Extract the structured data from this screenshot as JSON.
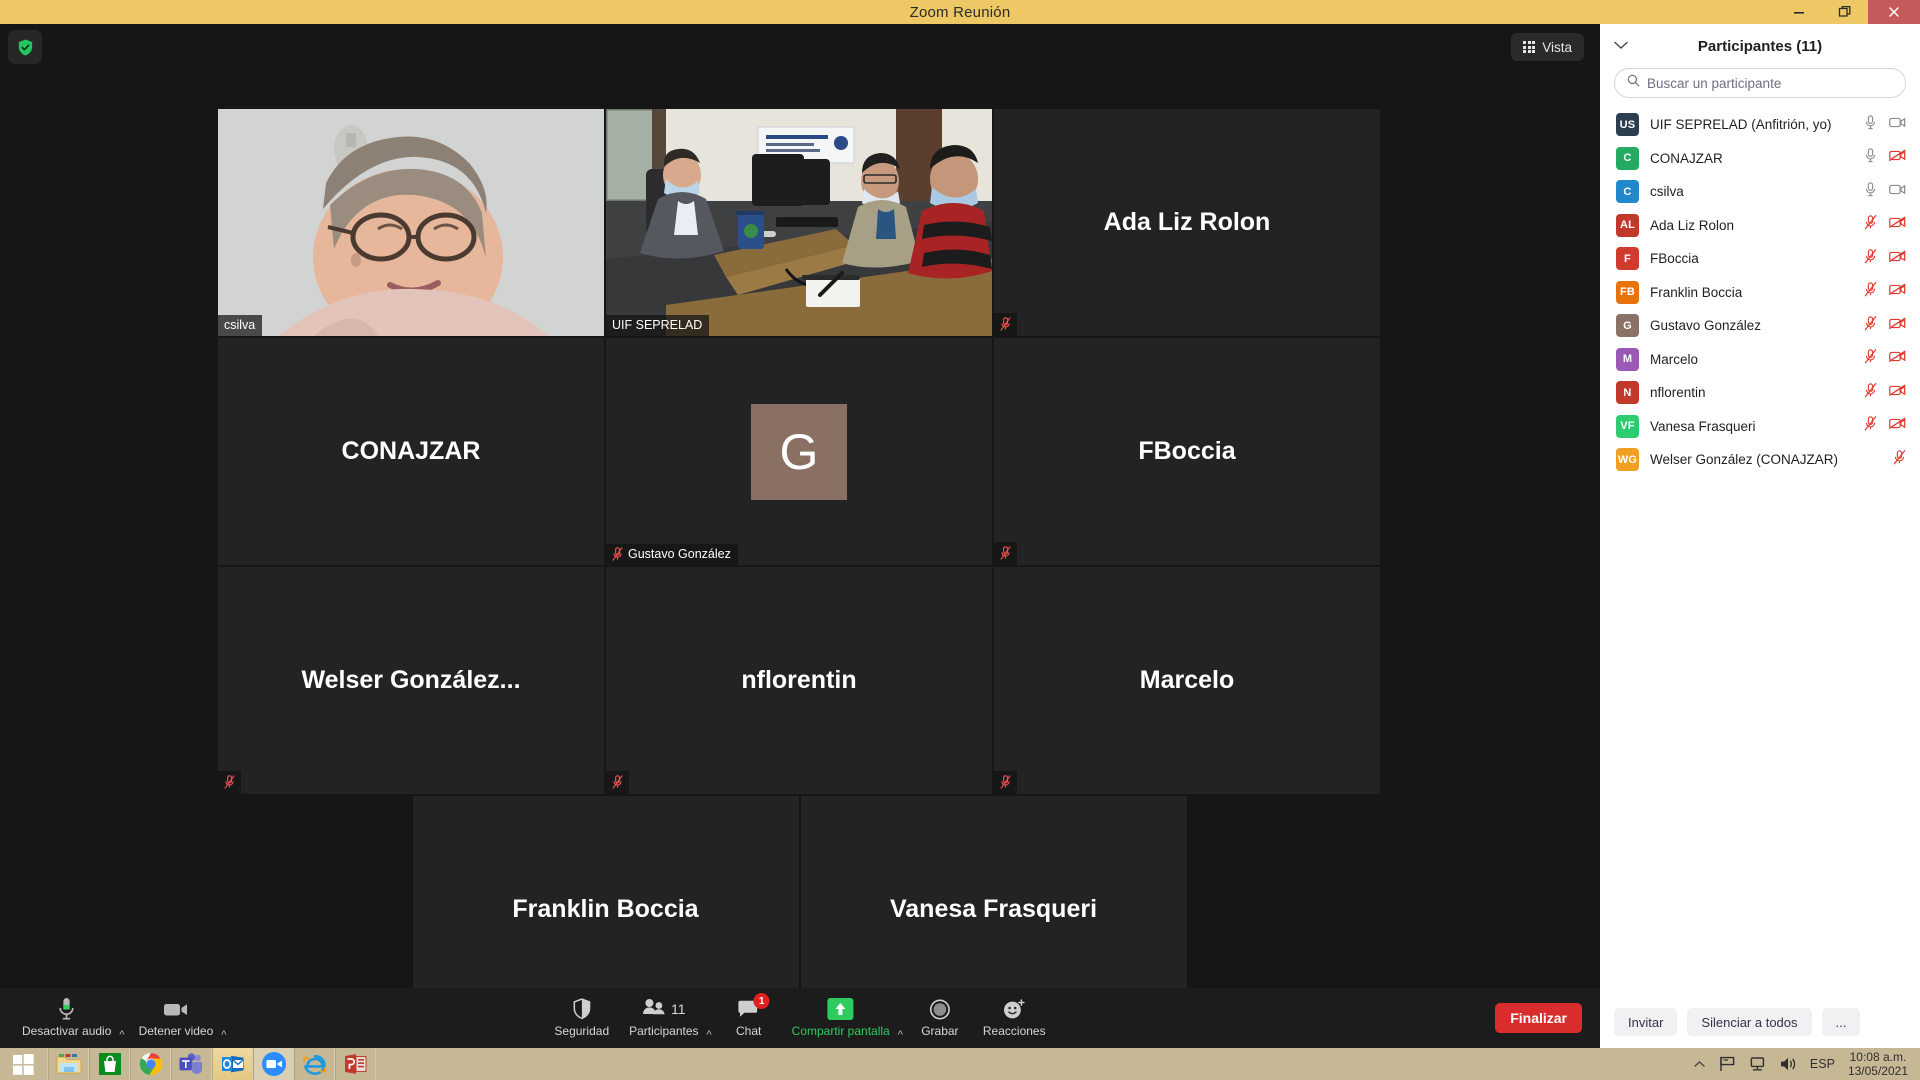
{
  "window": {
    "title": "Zoom Reunión",
    "minimize_label": "Minimizar",
    "restore_label": "Restaurar",
    "close_label": "Cerrar"
  },
  "stage": {
    "encryption_icon": "shield-check-icon",
    "view_button": "Vista",
    "view_icon": "grid-icon"
  },
  "tiles": [
    {
      "name": "csilva",
      "type": "video",
      "badge": "csilva",
      "muted": false,
      "active": false,
      "label_style": "badge"
    },
    {
      "name": "UIF SEPRELAD",
      "type": "video",
      "badge": "UIF SEPRELAD",
      "muted": false,
      "active": true,
      "label_style": "badge"
    },
    {
      "name": "Ada Liz Rolon",
      "type": "name",
      "muted": true,
      "active": false,
      "label_style": "center"
    },
    {
      "name": "CONAJZAR",
      "type": "name",
      "muted": false,
      "active": false,
      "label_style": "center"
    },
    {
      "name": "Gustavo González",
      "type": "avatar",
      "initial": "G",
      "avatar_color": "#8a6f63",
      "muted": true,
      "active": false,
      "label_style": "badge"
    },
    {
      "name": "FBoccia",
      "type": "name",
      "muted": true,
      "active": false,
      "label_style": "center"
    },
    {
      "name": "Welser  González...",
      "type": "name",
      "muted": true,
      "active": false,
      "label_style": "center"
    },
    {
      "name": "nflorentin",
      "type": "name",
      "muted": true,
      "active": false,
      "label_style": "center"
    },
    {
      "name": "Marcelo",
      "type": "name",
      "muted": true,
      "active": false,
      "label_style": "center"
    },
    {
      "name": "Franklin Boccia",
      "type": "name",
      "muted": true,
      "active": false,
      "label_style": "center"
    },
    {
      "name": "Vanesa Frasqueri",
      "type": "name",
      "muted": true,
      "active": false,
      "label_style": "center"
    }
  ],
  "panel": {
    "title": "Participantes (11)",
    "collapse_icon": "chevron-down-icon",
    "search": {
      "placeholder": "Buscar un participante",
      "value": "",
      "icon": "search-icon"
    },
    "participants": [
      {
        "initials": "US",
        "name": "UIF SEPRELAD (Anfitrión, yo)",
        "color": "#2c3e50",
        "mic": "on",
        "cam": "on"
      },
      {
        "initials": "C",
        "name": "CONAJZAR",
        "color": "#22ab61",
        "mic": "on",
        "cam": "off"
      },
      {
        "initials": "C",
        "name": "csilva",
        "color": "#2288cc",
        "mic": "on",
        "cam": "on"
      },
      {
        "initials": "AL",
        "name": "Ada Liz Rolon",
        "color": "#c0392b",
        "mic": "muted",
        "cam": "off"
      },
      {
        "initials": "F",
        "name": "FBoccia",
        "color": "#d13b2e",
        "mic": "muted",
        "cam": "off"
      },
      {
        "initials": "FB",
        "name": "Franklin Boccia",
        "color": "#e8730c",
        "mic": "muted",
        "cam": "off"
      },
      {
        "initials": "G",
        "name": "Gustavo González",
        "color": "#8a7266",
        "mic": "muted",
        "cam": "off"
      },
      {
        "initials": "M",
        "name": "Marcelo",
        "color": "#9b59b6",
        "mic": "muted",
        "cam": "off"
      },
      {
        "initials": "N",
        "name": "nflorentin",
        "color": "#c0392b",
        "mic": "muted",
        "cam": "off"
      },
      {
        "initials": "VF",
        "name": "Vanesa Frasqueri",
        "color": "#2ecc71",
        "mic": "muted",
        "cam": "off"
      },
      {
        "initials": "WG",
        "name": "Welser González (CONAJZAR)",
        "color": "#f0a020",
        "mic": "muted",
        "cam": "none"
      }
    ],
    "footer": {
      "invite": "Invitar",
      "mute_all": "Silenciar a todos",
      "more": "..."
    }
  },
  "toolbar": {
    "audio": {
      "label": "Desactivar audio",
      "icon": "microphone-icon"
    },
    "video": {
      "label": "Detener video",
      "icon": "camera-icon"
    },
    "security": {
      "label": "Seguridad",
      "icon": "shield-icon"
    },
    "participants": {
      "label": "Participantes",
      "count": "11",
      "icon": "people-icon"
    },
    "chat": {
      "label": "Chat",
      "badge": "1",
      "icon": "chat-bubble-icon"
    },
    "share": {
      "label": "Compartir pantalla",
      "icon": "share-up-arrow-icon"
    },
    "record": {
      "label": "Grabar",
      "icon": "record-circle-icon"
    },
    "reactions": {
      "label": "Reacciones",
      "icon": "smiley-plus-icon"
    },
    "end": {
      "label": "Finalizar"
    },
    "accent_green": "#2ecc5e",
    "accent_red": "#d92d2d"
  },
  "taskbar": {
    "apps": [
      {
        "name": "start-button",
        "icon": "windows-logo-icon"
      },
      {
        "name": "file-explorer",
        "icon": "folder-icon"
      },
      {
        "name": "microsoft-store",
        "icon": "store-bag-icon"
      },
      {
        "name": "google-chrome",
        "icon": "chrome-icon"
      },
      {
        "name": "microsoft-teams",
        "icon": "teams-icon"
      },
      {
        "name": "microsoft-outlook",
        "icon": "outlook-icon"
      },
      {
        "name": "zoom",
        "icon": "zoom-camera-icon"
      },
      {
        "name": "internet-explorer",
        "icon": "internet-explorer-icon"
      },
      {
        "name": "microsoft-powerpoint",
        "icon": "powerpoint-icon"
      }
    ],
    "tray": {
      "show_hidden_icon": "chevron-up-icon",
      "action_center_icon": "flag-icon",
      "network_icon": "network-icon",
      "volume_icon": "speaker-icon",
      "language": "ESP",
      "time": "10:08 a.m.",
      "date": "13/05/2021"
    }
  }
}
